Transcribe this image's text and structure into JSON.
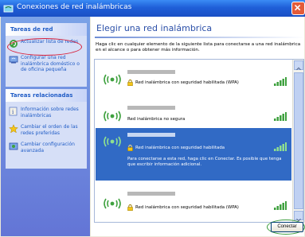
{
  "window": {
    "title": "Conexiones de red inalámbricas",
    "icon": "network-icon"
  },
  "sidebar": {
    "network_tasks": {
      "title": "Tareas de red",
      "items": [
        {
          "label": "Actualizar lista de redes",
          "icon": "refresh-icon"
        },
        {
          "label": "Configurar una red inalámbrica doméstico o de oficina pequeña",
          "icon": "setup-network-icon"
        }
      ]
    },
    "related_tasks": {
      "title": "Tareas relacionadas",
      "items": [
        {
          "label": "Información sobre redes inalámbricas",
          "icon": "info-icon"
        },
        {
          "label": "Cambiar el orden de las redes preferidas",
          "icon": "star-icon"
        },
        {
          "label": "Cambiar configuración avanzada",
          "icon": "settings-icon"
        }
      ]
    }
  },
  "main": {
    "heading": "Elegir una red inalámbrica",
    "intro": "Haga clic en cualquier elemento de la siguiente lista para conectarse a una red inalámbrica en el alcance o para obtener más información.",
    "networks": [
      {
        "status": "Red inalámbrica con seguridad habilitada (WPA)",
        "secured": true,
        "signal_bars": 4
      },
      {
        "status": "Red inalámbrica no segura",
        "secured": false,
        "signal_bars": 4
      },
      {
        "status": "Red inalámbrica con seguridad habilitada",
        "secured": true,
        "signal_bars": 4,
        "selected": true,
        "description": "Para conectarse a esta red, haga clic en Conectar. Es posible que tenga que escribir información adicional."
      },
      {
        "status": "Red inalámbrica con seguridad habilitada (WPA)",
        "secured": true,
        "signal_bars": 4
      }
    ],
    "connect_label": "Conectar"
  },
  "colors": {
    "titlebar": "#1F5FD8",
    "selection": "#316AC5",
    "link": "#215DC6",
    "annotation_red": "#D8203A",
    "annotation_green": "#3F9E3F"
  }
}
